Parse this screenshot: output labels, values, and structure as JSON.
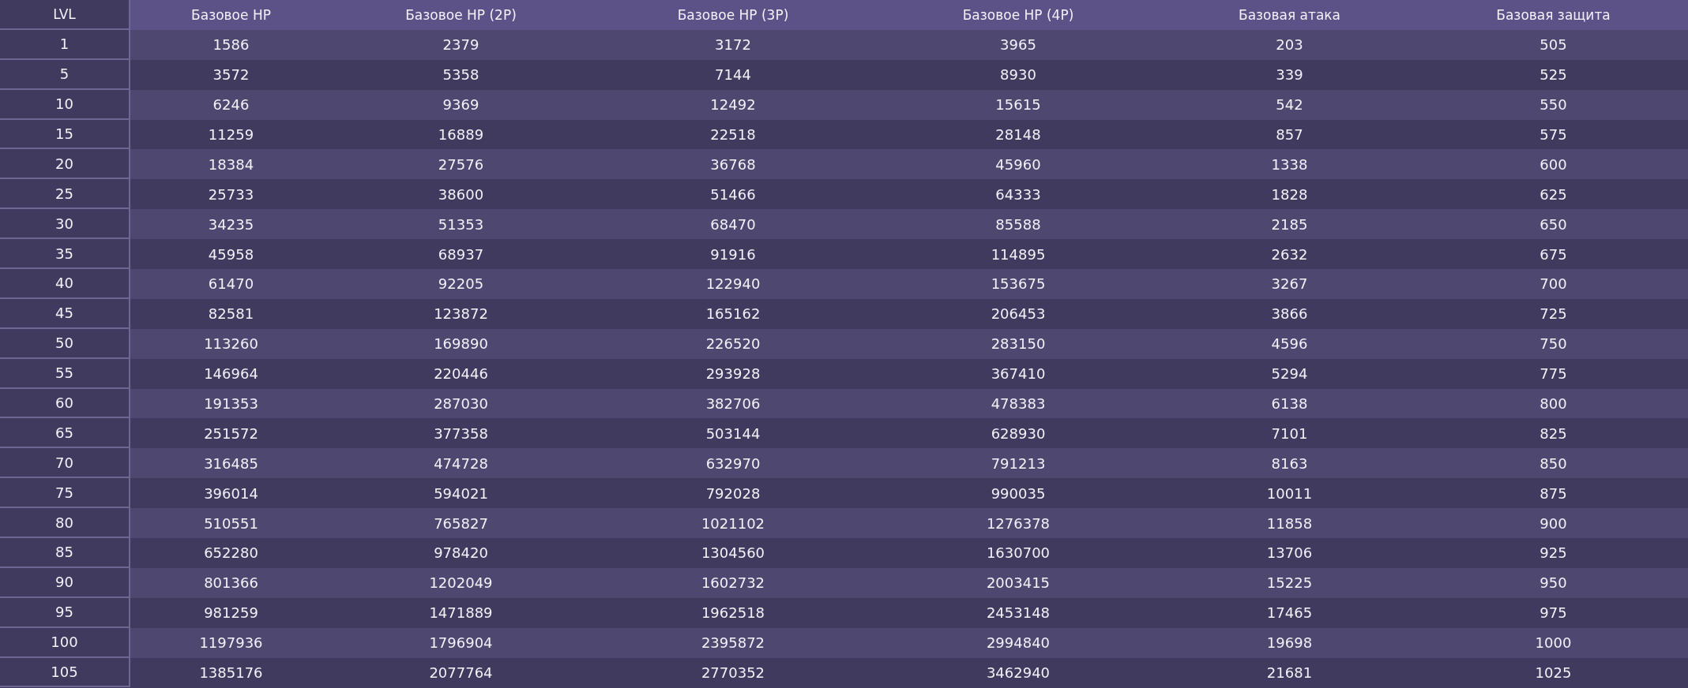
{
  "table": {
    "columns": [
      "LVL",
      "Базовое HP",
      "Базовое HP (2P)",
      "Базовое HP (3P)",
      "Базовое HP (4P)",
      "Базовая атака",
      "Базовая защита"
    ],
    "rows": [
      [
        "1",
        "1586",
        "2379",
        "3172",
        "3965",
        "203",
        "505"
      ],
      [
        "5",
        "3572",
        "5358",
        "7144",
        "8930",
        "339",
        "525"
      ],
      [
        "10",
        "6246",
        "9369",
        "12492",
        "15615",
        "542",
        "550"
      ],
      [
        "15",
        "11259",
        "16889",
        "22518",
        "28148",
        "857",
        "575"
      ],
      [
        "20",
        "18384",
        "27576",
        "36768",
        "45960",
        "1338",
        "600"
      ],
      [
        "25",
        "25733",
        "38600",
        "51466",
        "64333",
        "1828",
        "625"
      ],
      [
        "30",
        "34235",
        "51353",
        "68470",
        "85588",
        "2185",
        "650"
      ],
      [
        "35",
        "45958",
        "68937",
        "91916",
        "114895",
        "2632",
        "675"
      ],
      [
        "40",
        "61470",
        "92205",
        "122940",
        "153675",
        "3267",
        "700"
      ],
      [
        "45",
        "82581",
        "123872",
        "165162",
        "206453",
        "3866",
        "725"
      ],
      [
        "50",
        "113260",
        "169890",
        "226520",
        "283150",
        "4596",
        "750"
      ],
      [
        "55",
        "146964",
        "220446",
        "293928",
        "367410",
        "5294",
        "775"
      ],
      [
        "60",
        "191353",
        "287030",
        "382706",
        "478383",
        "6138",
        "800"
      ],
      [
        "65",
        "251572",
        "377358",
        "503144",
        "628930",
        "7101",
        "825"
      ],
      [
        "70",
        "316485",
        "474728",
        "632970",
        "791213",
        "8163",
        "850"
      ],
      [
        "75",
        "396014",
        "594021",
        "792028",
        "990035",
        "10011",
        "875"
      ],
      [
        "80",
        "510551",
        "765827",
        "1021102",
        "1276378",
        "11858",
        "900"
      ],
      [
        "85",
        "652280",
        "978420",
        "1304560",
        "1630700",
        "13706",
        "925"
      ],
      [
        "90",
        "801366",
        "1202049",
        "1602732",
        "2003415",
        "15225",
        "950"
      ],
      [
        "95",
        "981259",
        "1471889",
        "1962518",
        "2453148",
        "17465",
        "975"
      ],
      [
        "100",
        "1197936",
        "1796904",
        "2395872",
        "2994840",
        "19698",
        "1000"
      ],
      [
        "105",
        "1385176",
        "2077764",
        "2770352",
        "3462940",
        "21681",
        "1025"
      ]
    ]
  }
}
